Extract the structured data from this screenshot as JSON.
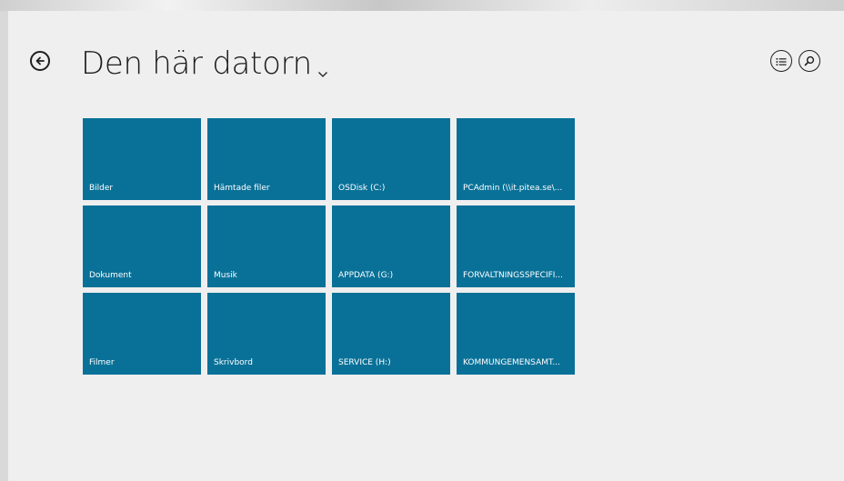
{
  "header": {
    "title": "Den här datorn",
    "back_icon": "back-arrow-icon",
    "dropdown_icon": "chevron-down-icon",
    "view_options_icon": "list-icon",
    "search_icon": "search-icon"
  },
  "colors": {
    "tile": "#097198",
    "background": "#efefef",
    "text": "#1b1b1b"
  },
  "tiles": [
    {
      "label": "Bilder"
    },
    {
      "label": "Hämtade filer"
    },
    {
      "label": "OSDisk (C:)"
    },
    {
      "label": "PCAdmin (\\\\it.pitea.se\\..."
    },
    {
      "label": "Dokument"
    },
    {
      "label": "Musik"
    },
    {
      "label": "APPDATA (G:)"
    },
    {
      "label": "FÖRVALTNINGSSPECIFI..."
    },
    {
      "label": "Filmer"
    },
    {
      "label": "Skrivbord"
    },
    {
      "label": "SERVICE (H:)"
    },
    {
      "label": "KOMMUNGEMENSAMT..."
    }
  ]
}
